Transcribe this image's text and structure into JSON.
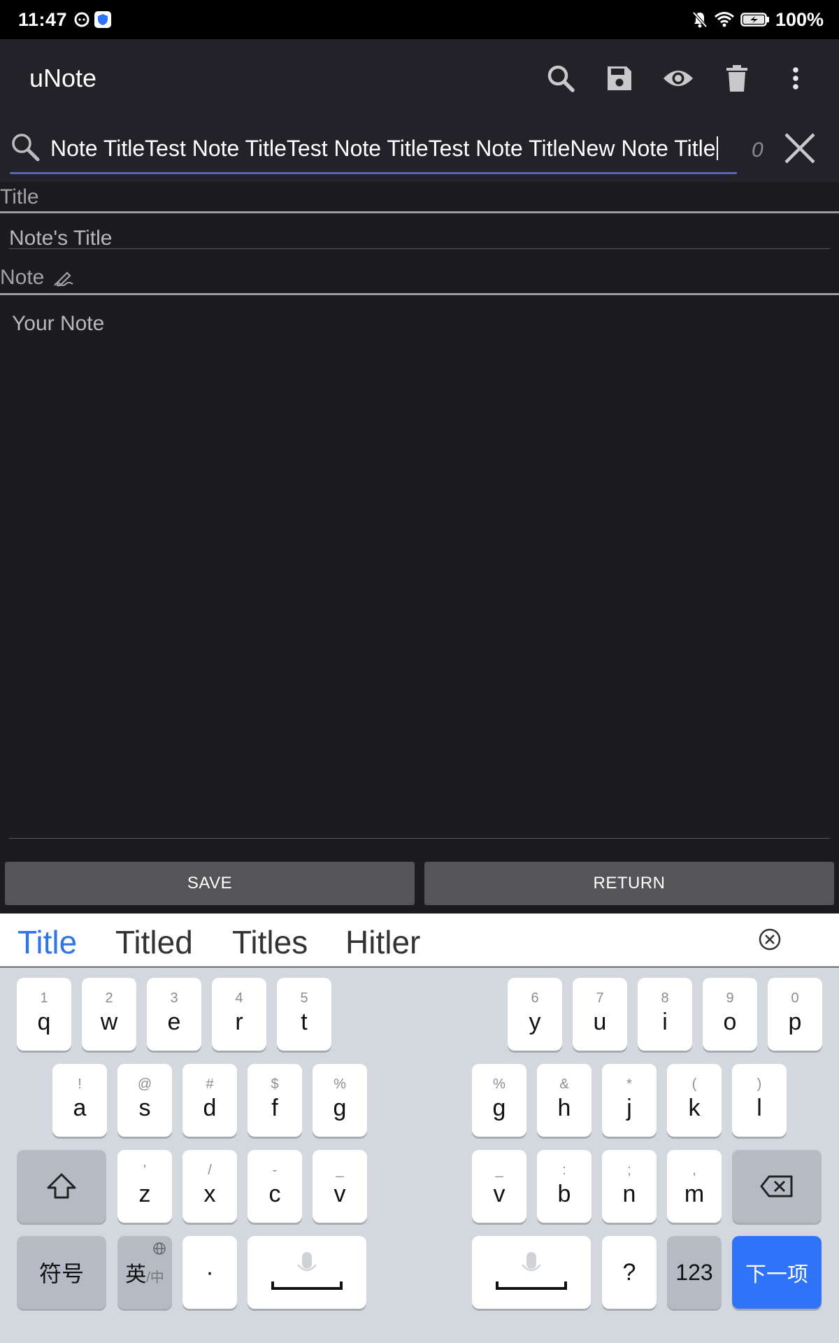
{
  "status_bar": {
    "time": "11:47",
    "battery": "100%"
  },
  "app_bar": {
    "title": "uNote",
    "actions": [
      "search-icon",
      "save-icon",
      "eye-icon",
      "delete-icon",
      "more-vert-icon"
    ]
  },
  "search": {
    "query": "Note TitleTest Note TitleTest Note TitleTest Note TitleNew Note Title",
    "match_count": "0"
  },
  "form": {
    "title_label": "Title",
    "title_placeholder": "Note's Title",
    "note_label": "Note",
    "note_placeholder": "Your Note"
  },
  "buttons": {
    "save": "SAVE",
    "return": "RETURN"
  },
  "keyboard": {
    "suggestions": [
      "Title",
      "Titled",
      "Titles",
      "Hitler"
    ],
    "row1_left": [
      [
        "1",
        "q"
      ],
      [
        "2",
        "w"
      ],
      [
        "3",
        "e"
      ],
      [
        "4",
        "r"
      ],
      [
        "5",
        "t"
      ]
    ],
    "row1_right": [
      [
        "6",
        "y"
      ],
      [
        "7",
        "u"
      ],
      [
        "8",
        "i"
      ],
      [
        "9",
        "o"
      ],
      [
        "0",
        "p"
      ]
    ],
    "row2_left": [
      [
        "!",
        "a"
      ],
      [
        "@",
        "s"
      ],
      [
        "#",
        "d"
      ],
      [
        "$",
        "f"
      ],
      [
        "%",
        "g"
      ]
    ],
    "row2_right": [
      [
        "%",
        "g"
      ],
      [
        "&",
        "h"
      ],
      [
        "*",
        "j"
      ],
      [
        "(",
        "k"
      ],
      [
        ")",
        "l"
      ]
    ],
    "row3_left": [
      [
        "'",
        "z"
      ],
      [
        "/",
        "x"
      ],
      [
        "-",
        "c"
      ],
      [
        "_",
        "v"
      ]
    ],
    "row3_right": [
      [
        "_",
        "v"
      ],
      [
        ":",
        "b"
      ],
      [
        ";",
        "n"
      ],
      [
        ",",
        "m"
      ]
    ],
    "symbols_label": "符号",
    "lang_label": "英",
    "lang_sub": "/中",
    "dot": "·",
    "question": "?",
    "numbers_label": "123",
    "next_label": "下一项",
    "colors": {
      "accent": "#2f74f8",
      "suggest_active": "#2f74e8"
    }
  }
}
